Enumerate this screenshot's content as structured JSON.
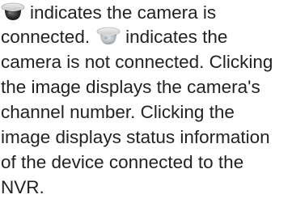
{
  "icons": {
    "connected": "camera-dome-connected-icon",
    "disconnected": "camera-dome-disconnected-icon"
  },
  "colors": {
    "connected_dome": "#2b2b2b",
    "disconnected_dome": "#b8bcc0",
    "text": "#222222"
  },
  "text": {
    "line1": "indicates the camera is",
    "line2a": "connected.",
    "line2b": "indicates the",
    "line3": "camera is not connected. Clicking",
    "line4": "the image displays the camera's",
    "line5": "channel number. Clicking the",
    "line6": "image displays status information",
    "line7": "of the device connected to the",
    "line8": "NVR."
  }
}
